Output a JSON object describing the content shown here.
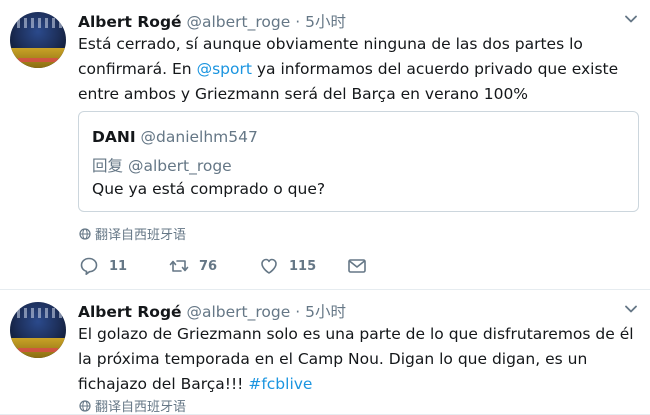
{
  "tweets": [
    {
      "author_name": "Albert Rogé",
      "handle": "@albert_roge",
      "separator": "·",
      "time": "5小时",
      "text_parts": [
        {
          "text": "Está cerrado, sí aunque obviamente ninguna de las dos partes lo confirmará. En ",
          "link": false
        },
        {
          "text": "@sport",
          "link": true
        },
        {
          "text": " ya informamos del acuerdo privado que existe entre ambos y Griezmann será del Barça en verano 100%",
          "link": false
        }
      ],
      "quoted": {
        "author_name": "DANI",
        "handle": "@danielhm547",
        "reply_prefix": "回复",
        "reply_to": "@albert_roge",
        "text": "Que ya está comprado o que?"
      },
      "translate_label": "翻译自西班牙语",
      "actions": {
        "replies": "11",
        "retweets": "76",
        "likes": "115"
      }
    },
    {
      "author_name": "Albert Rogé",
      "handle": "@albert_roge",
      "separator": "·",
      "time": "5小时",
      "text_parts": [
        {
          "text": "El golazo de Griezmann solo es una parte de lo que disfrutaremos de él la próxima temporada en el Camp Nou. Digan lo que digan, es un fichajazo del Barça!!! ",
          "link": false
        },
        {
          "text": "#fcblive",
          "link": true
        }
      ],
      "translate_label": "翻译自西班牙语"
    }
  ],
  "colors": {
    "link": "#1b95e0",
    "secondary": "#657786",
    "border": "#e6ecf0"
  },
  "icons": [
    "more-options-caret-icon",
    "globe-icon",
    "reply-icon",
    "retweet-icon",
    "like-heart-icon",
    "direct-message-envelope-icon"
  ]
}
